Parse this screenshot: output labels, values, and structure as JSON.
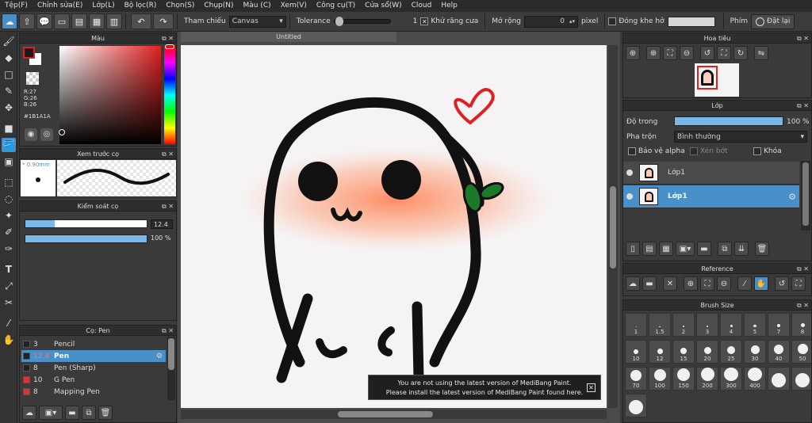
{
  "menu": [
    "Tệp(F)",
    "Chỉnh sửa(E)",
    "Lớp(L)",
    "Bộ lọc(R)",
    "Chọn(S)",
    "Chụp(N)",
    "Màu (C)",
    "Xem(V)",
    "Công cụ(T)",
    "Cửa sổ(W)",
    "Cloud",
    "Help"
  ],
  "toolbar": {
    "reference_label": "Tham chiếu",
    "reference_value": "Canvas",
    "tolerance_label": "Tolerance",
    "tolerance_value": "1",
    "tolerance_fraction": 0.02,
    "antialias_label": "Khử răng cưa",
    "antialias_checked": true,
    "expand_label": "Mở rộng",
    "expand_value": "0",
    "expand_unit": "pixel",
    "close_gap_label": "Đóng khe hở",
    "key_label": "Phím",
    "reset_label": "Đặt lại"
  },
  "color_panel": {
    "title": "Màu",
    "r": "R:27",
    "g": "G:26",
    "b": "B:26",
    "hex": "#1B1A1A",
    "fg_color": "#1B1A1A",
    "bg_color": "#FFFFFF"
  },
  "brush_preview": {
    "title": "Xem trước cọ",
    "size": "* 0.90mm"
  },
  "brush_control": {
    "title": "Kiểm soát cọ",
    "size_value": "12.4",
    "size_fraction": 0.24,
    "opacity_value": "100 %",
    "opacity_fraction": 1.0
  },
  "brush_list": {
    "title": "Cọ: Pen",
    "items": [
      {
        "size": "3",
        "name": "Pencil",
        "color": "#222222",
        "selected": false
      },
      {
        "size": "12.4",
        "name": "Pen",
        "color": "#222222",
        "selected": true
      },
      {
        "size": "8",
        "name": "Pen (Sharp)",
        "color": "#222222",
        "selected": false
      },
      {
        "size": "10",
        "name": "G Pen",
        "color": "#d33",
        "selected": false
      },
      {
        "size": "8",
        "name": "Mapping Pen",
        "color": "#d33",
        "selected": false
      }
    ]
  },
  "canvas": {
    "tab_title": "Untitled"
  },
  "notice": {
    "line1": "You are not using the latest version of MediBang Paint.",
    "line2": "Please install the latest version of MediBang Paint found here."
  },
  "navigator": {
    "title": "Hoa tiêu"
  },
  "layer_panel": {
    "title": "Lớp",
    "opacity_label": "Độ trong",
    "opacity_value": "100 %",
    "opacity_fraction": 1.0,
    "blend_label": "Pha trộn",
    "blend_value": "Bình thường",
    "protect_alpha": "Bảo vệ alpha",
    "clipping": "Xén bớt",
    "lock": "Khóa",
    "layers": [
      {
        "name": "Lớp1",
        "selected": false
      },
      {
        "name": "Lớp1",
        "selected": true
      }
    ]
  },
  "reference_panel": {
    "title": "Reference"
  },
  "brush_size_panel": {
    "title": "Brush Size",
    "sizes": [
      "1",
      "1.5",
      "2",
      "3",
      "4",
      "5",
      "7",
      "8",
      "10",
      "12",
      "15",
      "20",
      "25",
      "30",
      "40",
      "50",
      "70",
      "100",
      "150",
      "200",
      "300",
      "400",
      "",
      "",
      ""
    ]
  },
  "colors": {
    "accent": "#4a90c8",
    "panel": "#3a3a3a",
    "header": "#2e2e2e"
  }
}
